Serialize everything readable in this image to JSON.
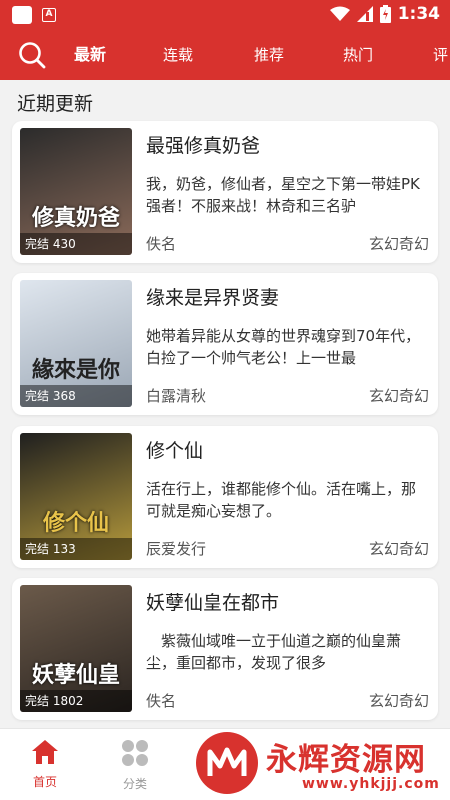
{
  "status_bar": {
    "time": "1:34"
  },
  "nav": {
    "tabs": [
      {
        "label": "最新",
        "active": true
      },
      {
        "label": "连载",
        "active": false
      },
      {
        "label": "推荐",
        "active": false
      },
      {
        "label": "热门",
        "active": false
      },
      {
        "label": "评",
        "active": false
      }
    ]
  },
  "section": {
    "title": "近期更新"
  },
  "books": [
    {
      "title": "最强修真奶爸",
      "description": "我，奶爸，修仙者，星空之下第一带娃PK强者！不服来战！林奇和三名驴",
      "author": "佚名",
      "genre": "玄幻奇幻",
      "badge": "完结 430",
      "cover_text": "修真奶爸",
      "cover_colors": [
        "#2b2b2b",
        "#8c6b5a"
      ]
    },
    {
      "title": "缘来是异界贤妻",
      "description": "她带着异能从女尊的世界魂穿到70年代，白捡了一个帅气老公！上一世最",
      "author": "白露清秋",
      "genre": "玄幻奇幻",
      "badge": "完结 368",
      "cover_text": "緣來是你",
      "cover_colors": [
        "#dfe6ee",
        "#9aa6b4"
      ]
    },
    {
      "title": "修个仙",
      "description": "活在行上，谁都能修个仙。活在嘴上，那可就是痴心妄想了。",
      "author": "辰爱发行",
      "genre": "玄幻奇幻",
      "badge": "完结 133",
      "cover_text": "修个仙",
      "cover_colors": [
        "#1f1f1f",
        "#b89c3c"
      ]
    },
    {
      "title": "妖孽仙皇在都市",
      "description": "　紫薇仙域唯一立于仙道之巅的仙皇萧尘，重回都市，发现了很多",
      "author": "佚名",
      "genre": "玄幻奇幻",
      "badge": "完结 1802",
      "cover_text": "妖孽仙皇",
      "cover_colors": [
        "#6b5a4a",
        "#2a2420"
      ]
    }
  ],
  "bottom_nav": {
    "items": [
      {
        "label": "首页",
        "active": true
      },
      {
        "label": "分类",
        "active": false
      }
    ]
  },
  "watermark": {
    "text": "永辉资源网",
    "url": "www.yhkjjj.com"
  },
  "colors": {
    "brand": "#d8322e",
    "background": "#f2f2f2"
  }
}
